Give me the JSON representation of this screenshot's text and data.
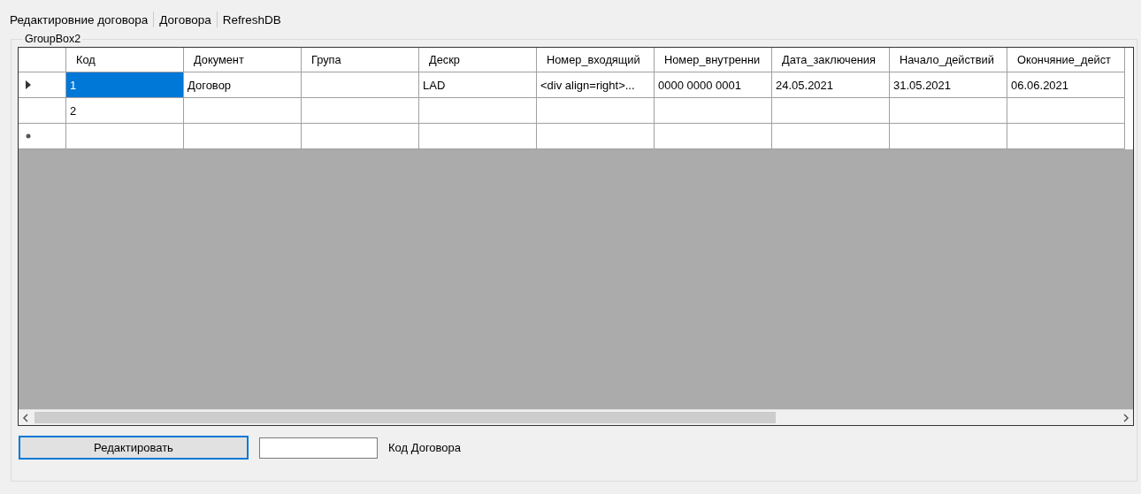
{
  "menu": [
    {
      "label": "Редактировние договора"
    },
    {
      "label": "Договора"
    },
    {
      "label": "RefreshDB"
    }
  ],
  "group_box": {
    "title": "GroupBox2"
  },
  "grid": {
    "columns": [
      "Код",
      "Документ",
      "Група",
      "Дескр",
      "Номер_входящий",
      "Номер_внутренни",
      "Дата_заключения",
      "Начало_действий",
      "Окончяние_дейст"
    ],
    "rows": [
      {
        "kind": "data",
        "current": true,
        "cells": [
          {
            "text": "1",
            "selected": true
          },
          {
            "text": "Договор",
            "selected": false
          },
          {
            "selected": false
          },
          {
            "text": "LAD",
            "selected": false
          },
          {
            "text": "<div align=right>...",
            "selected": false
          },
          {
            "text": "0000 0000 0001",
            "selected": false
          },
          {
            "text": "24.05.2021",
            "selected": false
          },
          {
            "text": "31.05.2021",
            "selected": false
          },
          {
            "text": "06.06.2021",
            "selected": false
          }
        ]
      },
      {
        "kind": "data",
        "current": false,
        "cells": [
          {
            "text": "2",
            "selected": false
          },
          {
            "selected": false
          },
          {
            "selected": false
          },
          {
            "selected": false
          },
          {
            "selected": false
          },
          {
            "selected": false
          },
          {
            "selected": false
          },
          {
            "selected": false
          },
          {
            "selected": false
          }
        ]
      },
      {
        "kind": "new",
        "current": false,
        "cells": [
          {
            "selected": false
          },
          {
            "selected": false
          },
          {
            "selected": false
          },
          {
            "selected": false
          },
          {
            "selected": false
          },
          {
            "selected": false
          },
          {
            "selected": false
          },
          {
            "selected": false
          },
          {
            "selected": false
          }
        ]
      }
    ]
  },
  "edit_button": {
    "label": "Редактировать",
    "focused": true
  },
  "code_label": "Код Договора"
}
